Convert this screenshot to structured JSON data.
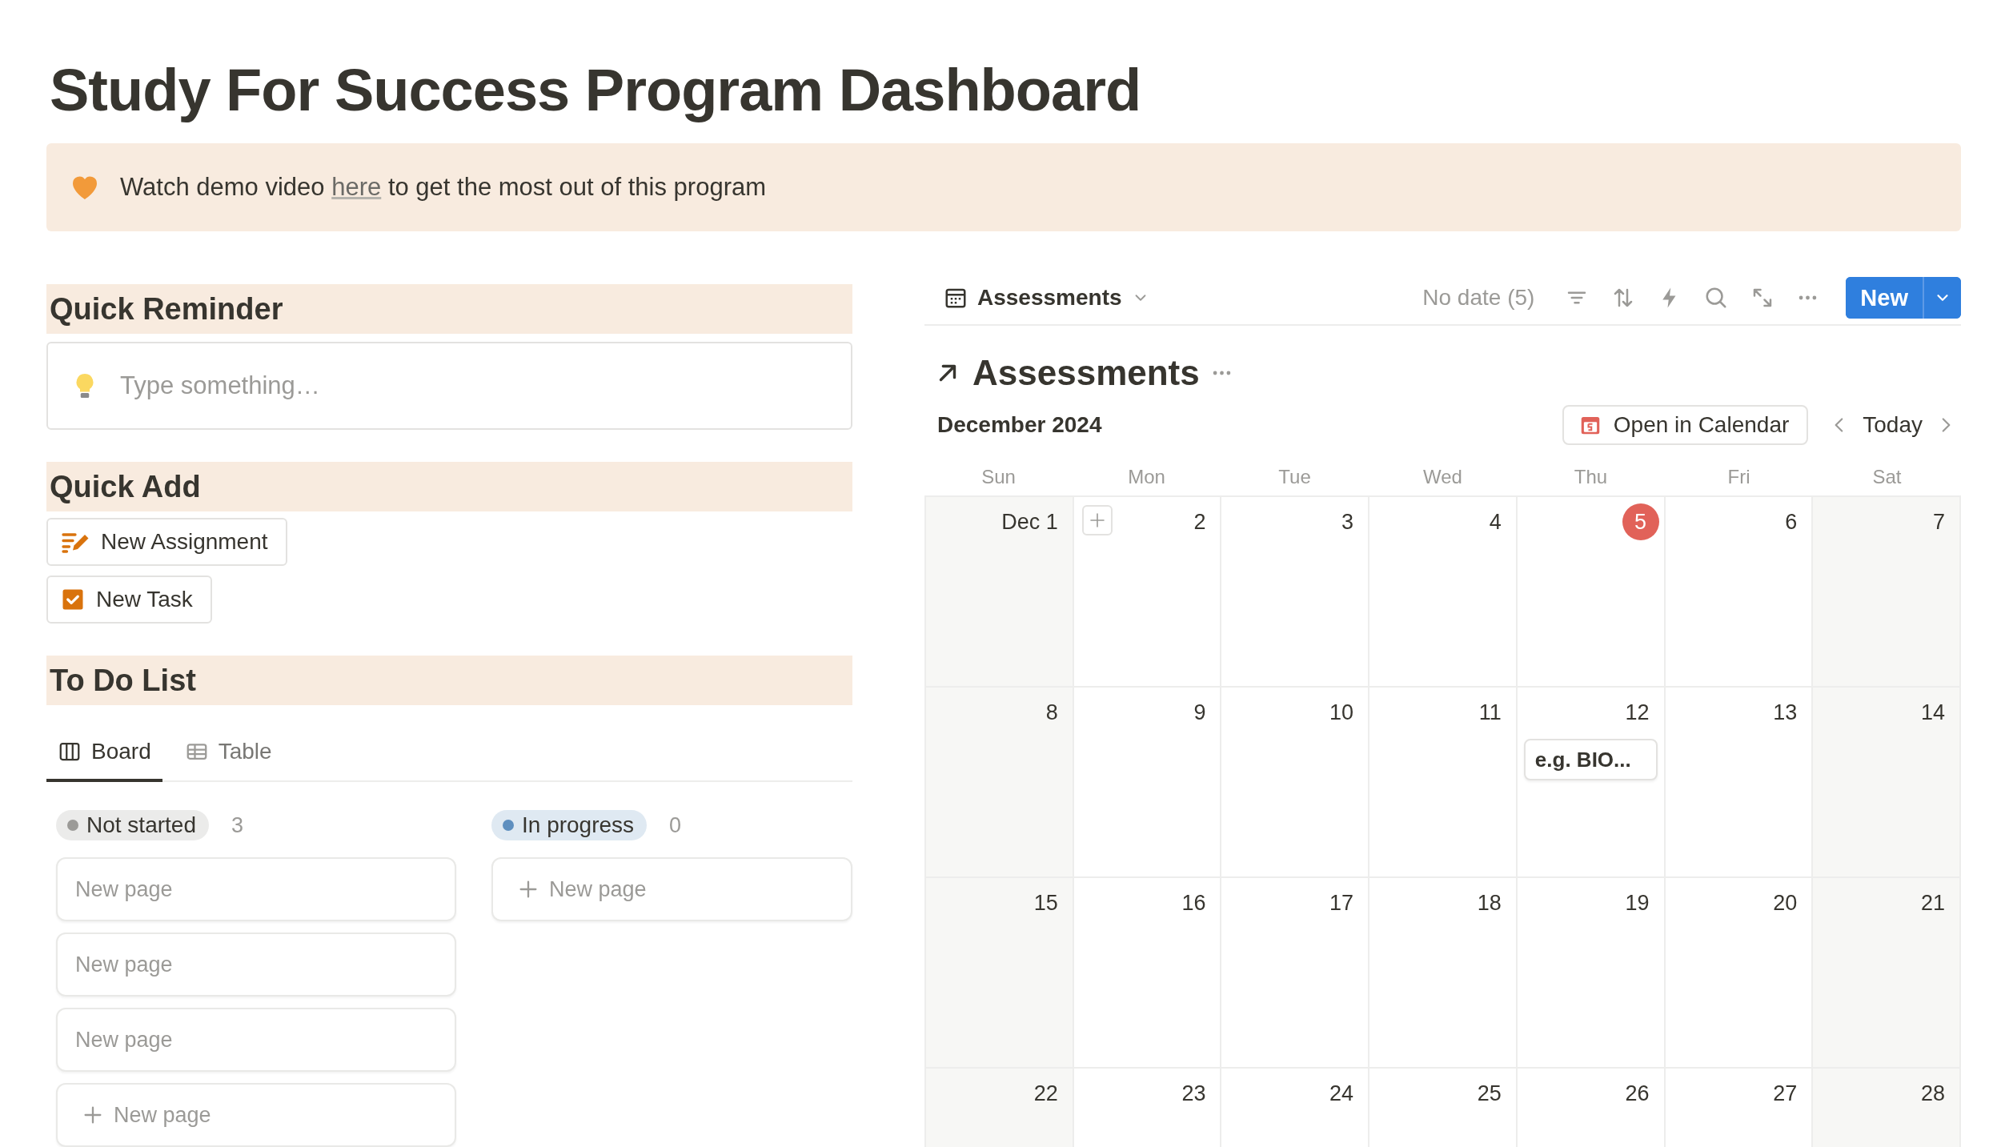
{
  "page_title": "Study For Success Program Dashboard",
  "callout": {
    "before": "Watch demo video",
    "link": "here",
    "after": "to get the most out of this program"
  },
  "quick_reminder": {
    "heading": "Quick Reminder",
    "placeholder": "Type something…"
  },
  "quick_add": {
    "heading": "Quick Add",
    "buttons": [
      {
        "label": "New Assignment",
        "kind": "assignment"
      },
      {
        "label": "New Task",
        "kind": "task"
      }
    ]
  },
  "todo": {
    "heading": "To Do List",
    "tabs": [
      {
        "label": "Board",
        "kind": "board",
        "selected": true
      },
      {
        "label": "Table",
        "kind": "table",
        "selected": false
      }
    ],
    "columns": [
      {
        "status": "Not started",
        "color": "#9b9a97",
        "count": "3",
        "cards": [
          "New page",
          "New page",
          "New page"
        ],
        "add": "New page"
      },
      {
        "status": "In progress",
        "color": "#5e8fbf",
        "count": "0",
        "add": "New page"
      }
    ]
  },
  "calendar": {
    "view": "Assessments",
    "no_date": "No date (5)",
    "new_button": "New",
    "title": "Assessments",
    "month": "December 2024",
    "open_in_calendar": "Open in Calendar",
    "today_button": "Today",
    "weekdays": [
      "Sun",
      "Mon",
      "Tue",
      "Wed",
      "Thu",
      "Fri",
      "Sat"
    ],
    "weeks": [
      [
        {
          "day": "Dec 1"
        },
        {
          "day": "2",
          "hovered": true
        },
        {
          "day": "3"
        },
        {
          "day": "4"
        },
        {
          "day": "5",
          "today": true
        },
        {
          "day": "6"
        },
        {
          "day": "7"
        }
      ],
      [
        {
          "day": "8"
        },
        {
          "day": "9"
        },
        {
          "day": "10"
        },
        {
          "day": "11"
        },
        {
          "day": "12",
          "events": [
            "e.g. BIO..."
          ]
        },
        {
          "day": "13"
        },
        {
          "day": "14"
        }
      ],
      [
        {
          "day": "15"
        },
        {
          "day": "16"
        },
        {
          "day": "17"
        },
        {
          "day": "18"
        },
        {
          "day": "19"
        },
        {
          "day": "20"
        },
        {
          "day": "21"
        }
      ],
      [
        {
          "day": "22"
        },
        {
          "day": "23"
        },
        {
          "day": "24"
        },
        {
          "day": "25"
        },
        {
          "day": "26"
        },
        {
          "day": "27"
        },
        {
          "day": "28"
        }
      ]
    ]
  }
}
